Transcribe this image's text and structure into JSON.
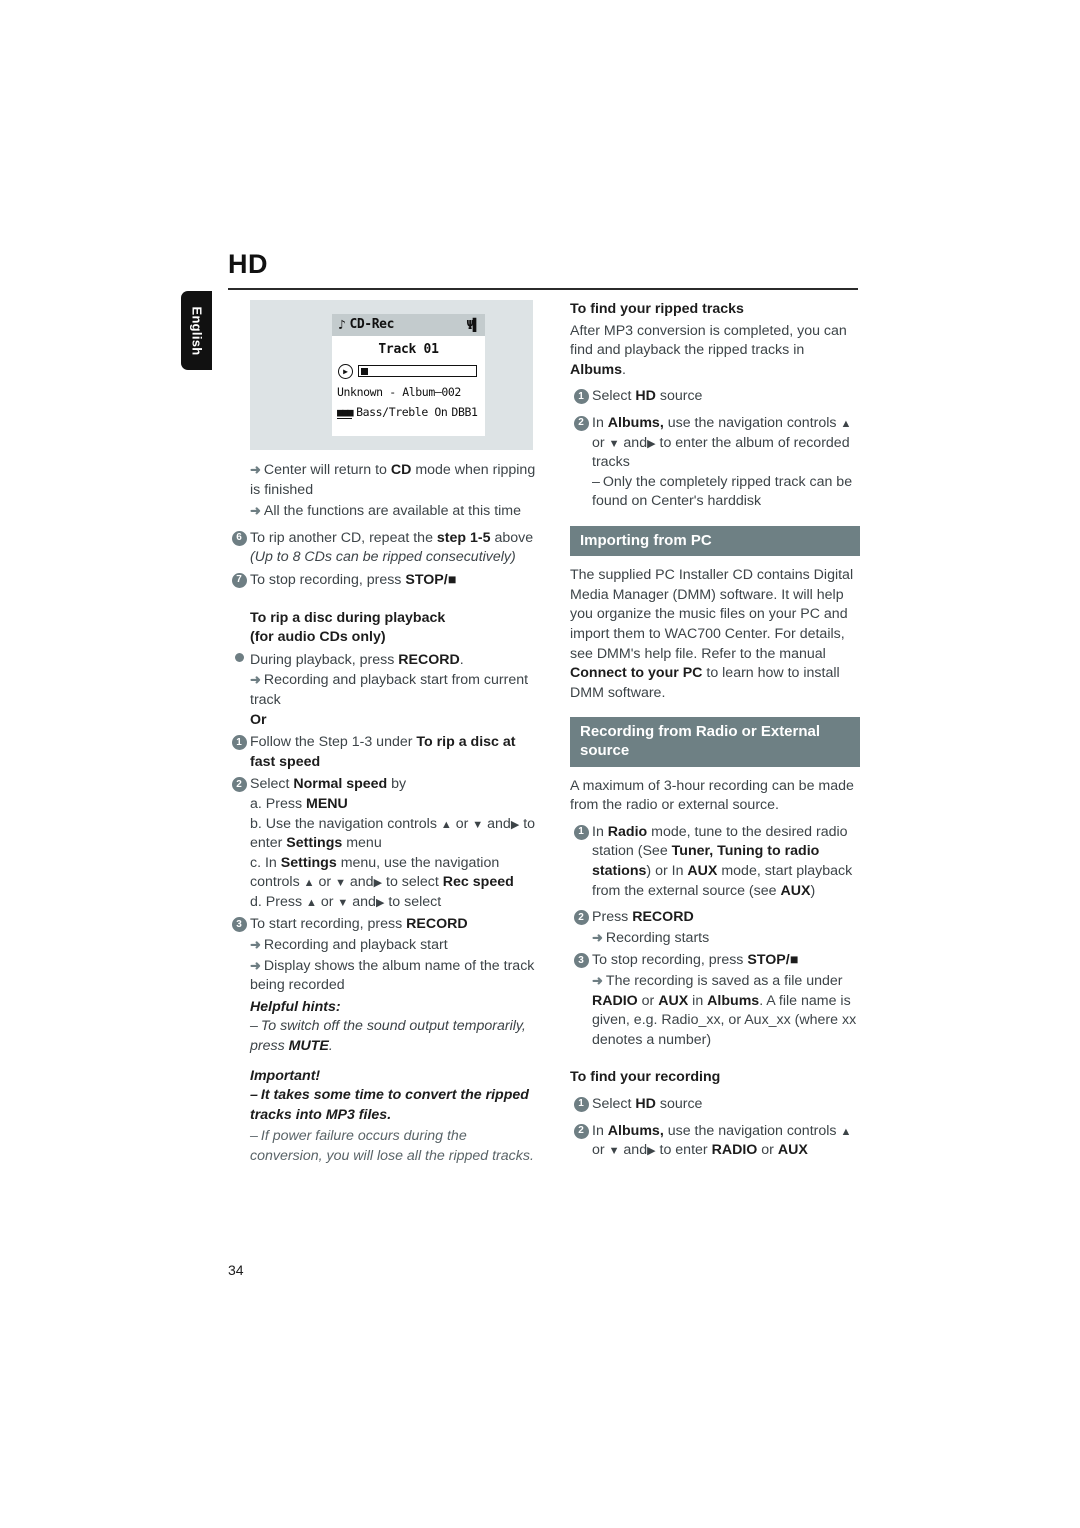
{
  "page": {
    "title": "HD",
    "language_tab": "English",
    "folio": "34",
    "accent_bar_color": "#6e8084",
    "bullet_color": "#6e7e83",
    "lcd_panel_color": "#dde3e5"
  },
  "lcd": {
    "note_icon": "music-note-icon",
    "mode": "CD-Rec",
    "signal_icon": "signal-strength-icon",
    "track": "Track 01",
    "play_icon": "play-icon",
    "album": "Unknown - Album—002",
    "eq_icon": "equalizer-icon",
    "bass": "Bass/Treble On",
    "dbb": "DBB1"
  },
  "left": {
    "arrow1": "Center will return to",
    "arrow1_b": "CD",
    "arrow1_c": "mode when ripping is finished",
    "arrow2": "All the functions are available at this time",
    "step6_num": "6",
    "step6_a": "To rip another CD, repeat the",
    "step6_b": "step 1-5",
    "step6_c": "above",
    "step6_note": "(Up to 8 CDs can be ripped consecutively)",
    "step7_num": "7",
    "step7_a": "To stop recording, press",
    "step7_b": "STOP/",
    "heading1_l1": "To rip a disc during playback",
    "heading1_l2": "(for audio CDs only)",
    "bullet_a": "During playback, press",
    "bullet_a_b": "RECORD",
    "bullet_a_c": ".",
    "bullet_a_arrow": "Recording and playback start from current track",
    "or": "Or",
    "s1_num": "1",
    "s1_a": "Follow the Step 1-3 under",
    "s1_b": "To rip a disc at fast speed",
    "s2_num": "2",
    "s2_a": "Select",
    "s2_b": "Normal speed",
    "s2_c": "by",
    "s2a": "a. Press",
    "s2a_b": "MENU",
    "s2b_1": "b. Use the navigation controls",
    "s2b_2": "or",
    "s2b_3": "and",
    "s2b_4": "to enter",
    "s2b_5": "Settings",
    "s2b_6": "menu",
    "s2c_1": "c. In",
    "s2c_2": "Settings",
    "s2c_3": "menu, use the navigation controls",
    "s2c_4": "or",
    "s2c_5": "and",
    "s2c_6": "to select",
    "s2c_7": "Rec speed",
    "s2d_1": "d. Press",
    "s2d_2": "or",
    "s2d_3": "and",
    "s2d_4": "to select",
    "s3_num": "3",
    "s3_a": "To start recording, press",
    "s3_b": "RECORD",
    "s3_arrow1": "Recording and playback start",
    "s3_arrow2": "Display shows the album name of the track being recorded",
    "hints_title": "Helpful hints:",
    "hint1_a": "To switch off the sound output temporarily, press",
    "hint1_b": "MUTE",
    "hint1_c": ".",
    "important_title": "Important!",
    "imp1": "It takes some time to convert the ripped tracks into MP3 files.",
    "imp2": "If power failure occurs during the conversion, you will lose all the ripped tracks."
  },
  "right": {
    "find_title": "To find your ripped tracks",
    "find_p1_a": "After MP3 conversion is completed, you can find and playback the ripped tracks in",
    "find_p1_b": "Albums",
    "find_p1_c": ".",
    "f1_num": "1",
    "f1_a": "Select",
    "f1_b": "HD",
    "f1_c": "source",
    "f2_num": "2",
    "f2_a": "In",
    "f2_b": "Albums,",
    "f2_c": "use the navigation controls",
    "f2_d": "or",
    "f2_e": "and",
    "f2_f": "to enter the album of recorded tracks",
    "f2_dash": "Only the completely ripped track can be found on Center's harddisk",
    "bar_importing": "Importing from PC",
    "importing_p1": "The supplied PC Installer CD contains Digital Media Manager (DMM) software.  It will help you organize the music files on your PC  and import them to WAC700 Center.  For details, see DMM's help file. Refer to the manual",
    "importing_p1_b": "Connect to your PC",
    "importing_p1_c": "to learn how to install DMM software.",
    "bar_recording": "Recording from Radio or External source",
    "recording_p1": "A maximum of 3-hour recording can be made from the radio or external source.",
    "r1_num": "1",
    "r1_a": "In",
    "r1_b": "Radio",
    "r1_c": "mode, tune to the desired radio station (See",
    "r1_d": "Tuner, Tuning to radio stations",
    "r1_e": ") or In",
    "r1_f": "AUX",
    "r1_g": "mode, start playback from the external source (see",
    "r1_h": "AUX",
    "r1_i": ")",
    "r2_num": "2",
    "r2_a": "Press",
    "r2_b": "RECORD",
    "r2_arrow": "Recording starts",
    "r3_num": "3",
    "r3_a": "To stop recording,  press",
    "r3_b": "STOP/",
    "r3_arrow_a": "The recording is saved as a file under",
    "r3_arrow_b": "RADIO",
    "r3_arrow_c": "or",
    "r3_arrow_d": "AUX",
    "r3_arrow_e": "in",
    "r3_arrow_f": "Albums",
    "r3_arrow_g": ". A file name is given, e.g. Radio_xx, or  Aux_xx (where xx denotes a number)",
    "find_rec_title": "To find your recording",
    "g1_num": "1",
    "g1_a": "Select",
    "g1_b": "HD",
    "g1_c": "source",
    "g2_num": "2",
    "g2_a": "In",
    "g2_b": "Albums,",
    "g2_c": "use the navigation controls",
    "g2_d": "or",
    "g2_e": "and",
    "g2_f": "to enter",
    "g2_g": "RADIO",
    "g2_h": "or",
    "g2_i": "AUX"
  }
}
